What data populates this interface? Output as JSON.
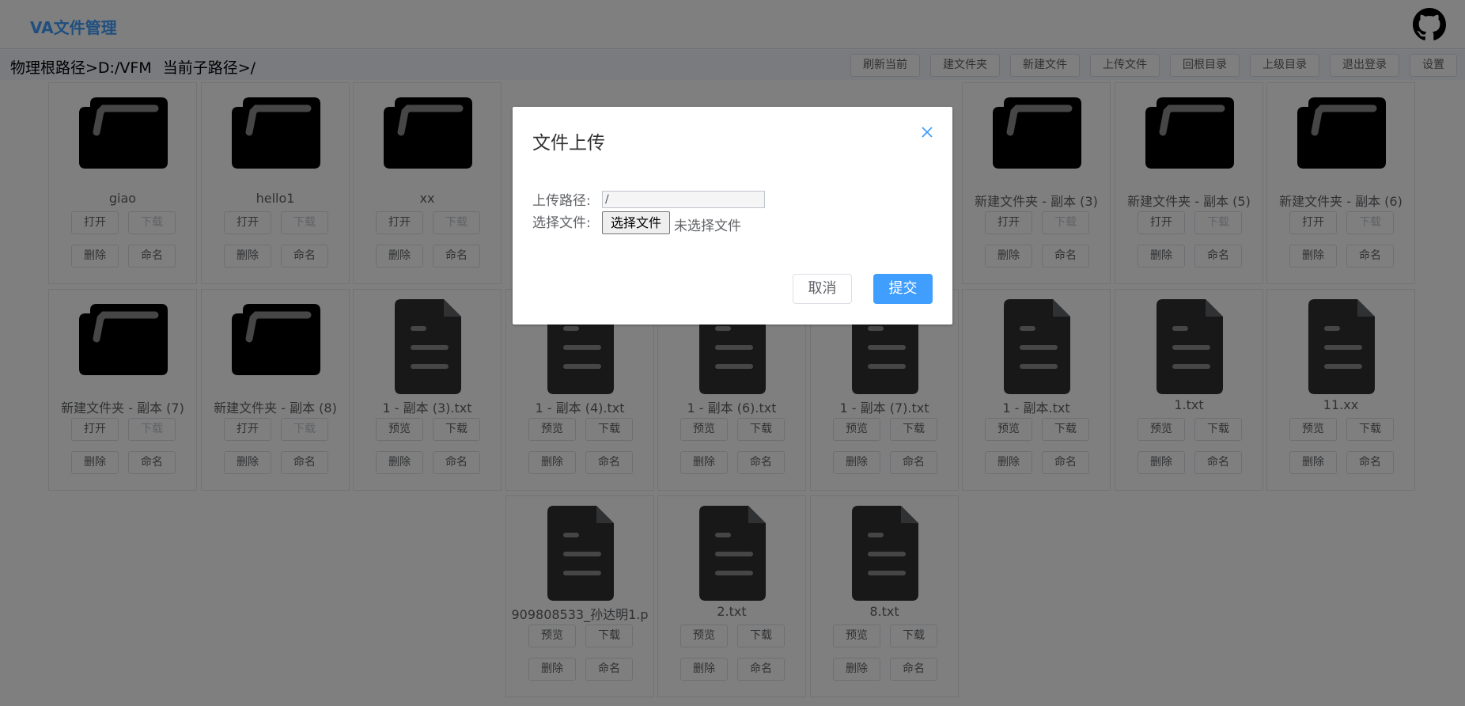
{
  "app": {
    "title": "VA文件管理",
    "github_icon": "github-icon"
  },
  "toolbar": {
    "root_path": "物理根路径>D:/VFM",
    "sub_path": "当前子路径>/",
    "buttons": [
      "刷新当前",
      "建文件夹",
      "新建文件",
      "上传文件",
      "回根目录",
      "上级目录",
      "退出登录",
      "设置"
    ]
  },
  "items": [
    {
      "name": "giao",
      "type": "folder",
      "actions": [
        "打开",
        "下载",
        "删除",
        "命名"
      ],
      "disabled": [
        1
      ]
    },
    {
      "name": "hello1",
      "type": "folder",
      "actions": [
        "打开",
        "下载",
        "删除",
        "命名"
      ],
      "disabled": [
        1
      ]
    },
    {
      "name": "xx",
      "type": "folder",
      "actions": [
        "打开",
        "下载",
        "删除",
        "命名"
      ],
      "disabled": [
        1
      ]
    },
    {
      "name": "",
      "type": "hidden"
    },
    {
      "name": "",
      "type": "hidden"
    },
    {
      "name": "",
      "type": "hidden"
    },
    {
      "name": "新建文件夹 - 副本 (3)",
      "type": "folder",
      "actions": [
        "打开",
        "下载",
        "删除",
        "命名"
      ],
      "disabled": [
        1
      ]
    },
    {
      "name": "新建文件夹 - 副本 (5)",
      "type": "folder",
      "actions": [
        "打开",
        "下载",
        "删除",
        "命名"
      ],
      "disabled": [
        1
      ]
    },
    {
      "name": "新建文件夹 - 副本 (6)",
      "type": "folder",
      "actions": [
        "打开",
        "下载",
        "删除",
        "命名"
      ],
      "disabled": [
        1
      ]
    },
    {
      "name": "新建文件夹 - 副本 (7)",
      "type": "folder",
      "actions": [
        "打开",
        "下载",
        "删除",
        "命名"
      ],
      "disabled": [
        1
      ]
    },
    {
      "name": "新建文件夹 - 副本 (8)",
      "type": "folder",
      "actions": [
        "打开",
        "下载",
        "删除",
        "命名"
      ],
      "disabled": [
        1
      ]
    },
    {
      "name": "1 - 副本 (3).txt",
      "type": "file",
      "actions": [
        "预览",
        "下载",
        "删除",
        "命名"
      ],
      "disabled": []
    },
    {
      "name": "1 - 副本 (4).txt",
      "type": "file",
      "actions": [
        "预览",
        "下载",
        "删除",
        "命名"
      ],
      "disabled": []
    },
    {
      "name": "1 - 副本 (6).txt",
      "type": "file",
      "actions": [
        "预览",
        "下载",
        "删除",
        "命名"
      ],
      "disabled": []
    },
    {
      "name": "1 - 副本 (7).txt",
      "type": "file",
      "actions": [
        "预览",
        "下载",
        "删除",
        "命名"
      ],
      "disabled": []
    },
    {
      "name": "1 - 副本.txt",
      "type": "file",
      "actions": [
        "预览",
        "下载",
        "删除",
        "命名"
      ],
      "disabled": []
    },
    {
      "name": "1.txt",
      "type": "file",
      "actions": [
        "预览",
        "下载",
        "删除",
        "命名"
      ],
      "disabled": []
    },
    {
      "name": "11.xx",
      "type": "file",
      "actions": [
        "预览",
        "下载",
        "删除",
        "命名"
      ],
      "disabled": []
    },
    {
      "name": "",
      "type": "empty"
    },
    {
      "name": "",
      "type": "empty"
    },
    {
      "name": "",
      "type": "empty"
    },
    {
      "name": "909808533_孙达明1.p",
      "type": "file",
      "actions": [
        "预览",
        "下载",
        "删除",
        "命名"
      ],
      "disabled": []
    },
    {
      "name": "2.txt",
      "type": "file",
      "actions": [
        "预览",
        "下载",
        "删除",
        "命名"
      ],
      "disabled": []
    },
    {
      "name": "8.txt",
      "type": "file",
      "actions": [
        "预览",
        "下载",
        "删除",
        "命名"
      ],
      "disabled": []
    }
  ],
  "dialog": {
    "title": "文件上传",
    "path_label": "上传路径:",
    "path_value": "/",
    "file_label": "选择文件:",
    "choose_button": "选择文件",
    "no_file_text": "未选择文件",
    "cancel": "取消",
    "submit": "提交"
  }
}
